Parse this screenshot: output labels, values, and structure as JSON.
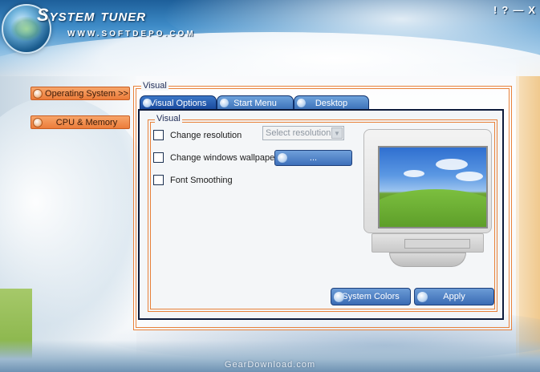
{
  "app": {
    "title": "System tuner",
    "subtitle": "WWW.SOFTDEPO.COM",
    "window_controls": {
      "help_label": "!",
      "about_label": "?",
      "minimize_label": "—",
      "close_label": "X"
    }
  },
  "sidebar": {
    "items": [
      {
        "label": "Operating System >>"
      },
      {
        "label": "CPU & Memory"
      }
    ]
  },
  "main": {
    "group_legend": "Visual",
    "tabs": [
      {
        "label": "Visual Options",
        "active": true
      },
      {
        "label": "Start Menu",
        "active": false
      },
      {
        "label": "Desktop",
        "active": false
      }
    ],
    "visual": {
      "legend": "Visual",
      "change_resolution_label": "Change resolution",
      "change_resolution_checked": false,
      "resolution_select_value": "Select resolution",
      "change_wallpaper_label": "Change windows wallpaper",
      "change_wallpaper_checked": false,
      "browse_label": "...",
      "font_smoothing_label": "Font Smoothing",
      "font_smoothing_checked": false
    },
    "buttons": {
      "system_colors_label": "System Colors",
      "apply_label": "Apply"
    }
  },
  "watermark": "GearDownload.com",
  "colors": {
    "accent_orange": "#ec7c3a",
    "tab_blue": "#17479b",
    "group_border": "#e8813a",
    "header_blue": "#1d5f9a"
  }
}
